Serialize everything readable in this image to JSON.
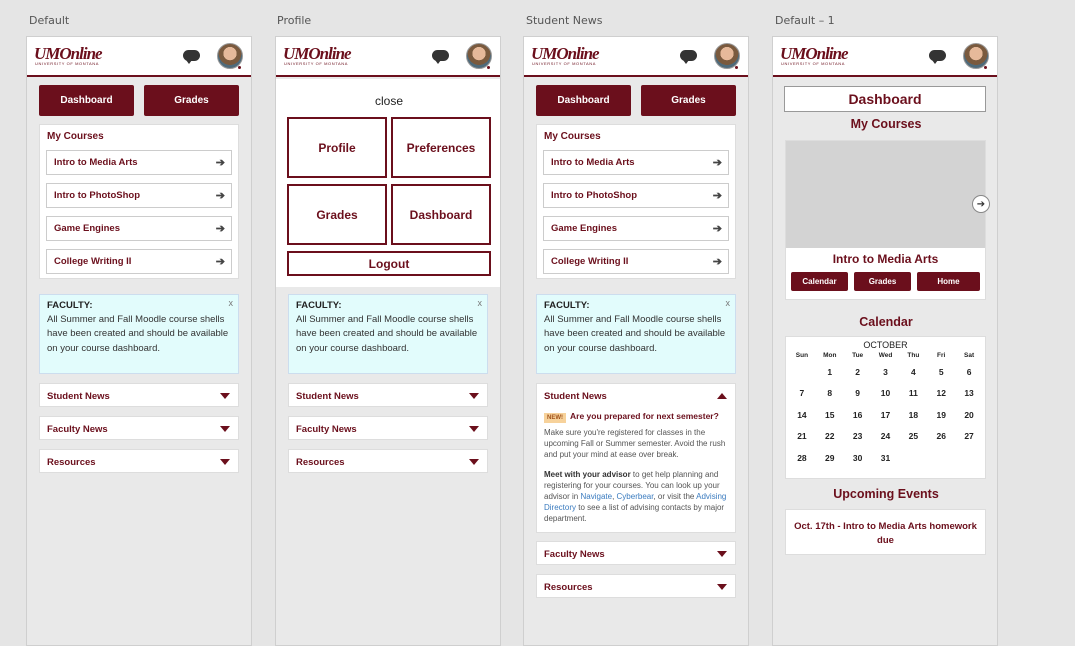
{
  "artboards": [
    "Default",
    "Profile",
    "Student News",
    "Default – 1"
  ],
  "brand": {
    "logo": "UMOnline",
    "logo_sub": "UNIVERSITY OF MONTANA",
    "accent": "#6b0f1c"
  },
  "nav": {
    "dashboard": "Dashboard",
    "grades": "Grades"
  },
  "courses": {
    "title": "My Courses",
    "items": [
      "Intro to Media Arts",
      "Intro to PhotoShop",
      "Game Engines",
      "College Writing II"
    ]
  },
  "alert": {
    "title": "FACULTY:",
    "body": "All Summer and Fall Moodle course shells have been created and should be available on your course dashboard.",
    "close": "x"
  },
  "accordions": {
    "student_news": "Student News",
    "faculty_news": "Faculty News",
    "resources": "Resources"
  },
  "menu": {
    "close": "close",
    "tiles": [
      "Profile",
      "Preferences",
      "Grades",
      "Dashboard"
    ],
    "logout": "Logout"
  },
  "news": {
    "badge": "NEW!",
    "headline": "Are you prepared for next semester?",
    "p1": "Make sure you're registered for classes in the upcoming Fall or Summer semester. Avoid the rush and put your mind at ease over break.",
    "p2_bold": "Meet with your advisor",
    "p2_a": "to get help planning and registering for your courses. You can look up your advisor in",
    "link1": "Navigate",
    "sep": ",",
    "link2": "Cyberbear",
    "p2_b": ", or visit the",
    "link3": "Advising Directory",
    "p2_c": "to see a list of advising contacts by major department."
  },
  "dashboard": {
    "title": "Dashboard",
    "my_courses": "My Courses",
    "featured_course": "Intro to Media Arts",
    "pills": [
      "Calendar",
      "Grades",
      "Home"
    ],
    "calendar_title": "Calendar",
    "month": "OCTOBER",
    "dow": [
      "Sun",
      "Mon",
      "Tue",
      "Wed",
      "Thu",
      "Fri",
      "Sat"
    ],
    "weeks": [
      [
        "",
        "1",
        "2",
        "3",
        "4",
        "5",
        "6"
      ],
      [
        "7",
        "8",
        "9",
        "10",
        "11",
        "12",
        "13"
      ],
      [
        "14",
        "15",
        "16",
        "17",
        "18",
        "19",
        "20"
      ],
      [
        "21",
        "22",
        "23",
        "24",
        "25",
        "26",
        "27"
      ],
      [
        "28",
        "29",
        "30",
        "31",
        "",
        "",
        ""
      ]
    ],
    "events_title": "Upcoming Events",
    "event": "Oct. 17th - Intro to Media Arts homework due"
  }
}
